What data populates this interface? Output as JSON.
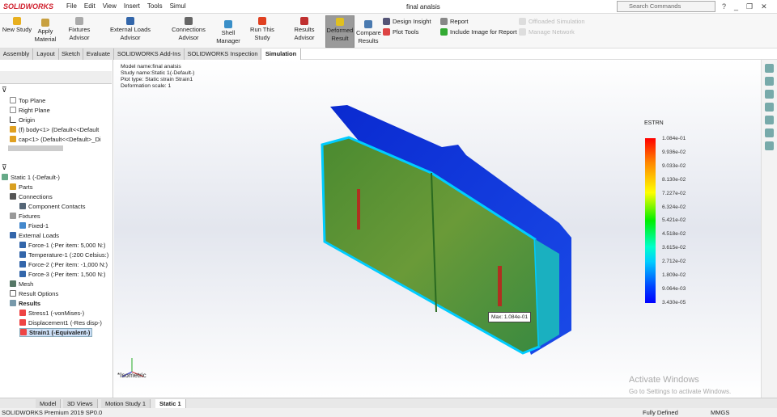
{
  "app": {
    "logo": "SOLIDWORKS",
    "window_title": "final analsis",
    "search_placeholder": "Search Commands"
  },
  "menu": [
    "File",
    "Edit",
    "View",
    "Insert",
    "Tools",
    "Simul"
  ],
  "ribbon": {
    "new_study": "New Study",
    "apply_material": "Apply Material",
    "fixtures_advisor": "Fixtures Advisor",
    "external_loads_advisor": "External Loads Advisor",
    "connections_advisor": "Connections Advisor",
    "shell_manager": "Shell Manager",
    "run_this_study": "Run This Study",
    "results_advisor": "Results Advisor",
    "deformed_result": "Deformed Result",
    "compare_results": "Compare Results",
    "design_insight": "Design Insight",
    "plot_tools": "Plot Tools",
    "report": "Report",
    "include_image": "Include Image for Report",
    "offloaded_simulation": "Offloaded Simulation",
    "manage_network": "Manage Network"
  },
  "tabs": [
    "Assembly",
    "Layout",
    "Sketch",
    "Evaluate",
    "SOLIDWORKS Add-Ins",
    "SOLIDWORKS Inspection",
    "Simulation"
  ],
  "feature_tree": [
    "Top Plane",
    "Right Plane",
    "Origin",
    "(f) body<1> (Default<<Default",
    "cap<1> (Default<<Default>_Di"
  ],
  "study_tree": {
    "root": "Static 1 (-Default-)",
    "parts": "Parts",
    "connections": "Connections",
    "component_contacts": "Component Contacts",
    "fixtures": "Fixtures",
    "fixed": "Fixed-1",
    "external_loads": "External Loads",
    "loads": [
      "Force-1 (:Per item: 5,000 N:)",
      "Temperature-1 (:200 Celsius:)",
      "Force-2 (:Per item: -1,000 N:)",
      "Force-3 (:Per item: 1,500 N:)"
    ],
    "mesh": "Mesh",
    "result_options": "Result Options",
    "results": "Results",
    "result_items": [
      "Stress1 (-vonMises-)",
      "Displacement1 (-Res disp-)",
      "Strain1 (-Equivalent-)"
    ]
  },
  "viewport": {
    "info": [
      "Model name:final analsis",
      "Study name:Static 1(-Default-)",
      "Plot type: Static strain Strain1",
      "Deformation scale: 1"
    ],
    "legend_title": "ESTRN",
    "legend_values": [
      "1.084e-01",
      "9.936e-02",
      "9.033e-02",
      "8.130e-02",
      "7.227e-02",
      "6.324e-02",
      "5.421e-02",
      "4.518e-02",
      "3.615e-02",
      "2.712e-02",
      "1.809e-02",
      "9.064e-03",
      "3.430e-05"
    ],
    "max_label": "Max: 1.084e-01",
    "view_name": "*Isometric",
    "watermark": "Activate Windows",
    "watermark_sub": "Go to Settings to activate Windows."
  },
  "bottom_tabs": [
    "Model",
    "3D Views",
    "Motion Study 1",
    "Static 1"
  ],
  "status": {
    "product": "SOLIDWORKS Premium 2019 SP0.0",
    "state": "Fully Defined",
    "units": "MMGS"
  }
}
